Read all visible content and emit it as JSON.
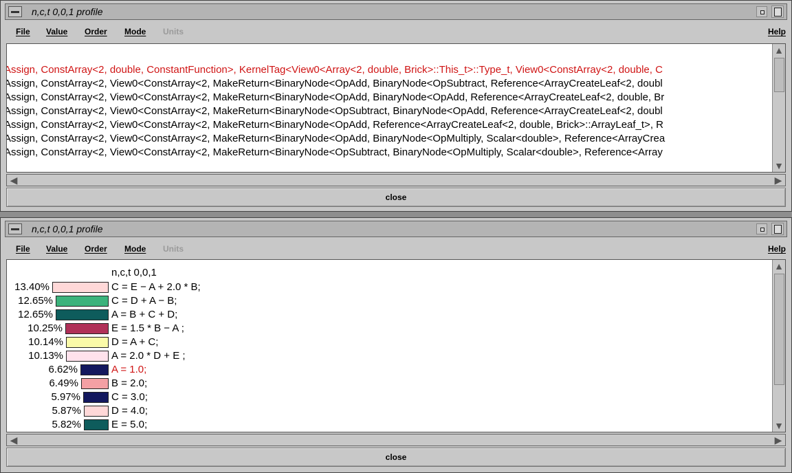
{
  "window_top": {
    "title": "n,c,t 0,0,1 profile",
    "menu": {
      "file": "File",
      "value": "Value",
      "order": "Order",
      "mode": "Mode",
      "units": "Units",
      "help": "Help"
    },
    "lines": [
      {
        "text": "Assign, ConstArray<2, double, ConstantFunction>, KernelTag<View0<Array<2, double, Brick>::This_t>::Type_t, View0<ConstArray<2, double, C",
        "highlight": true
      },
      {
        "text": "Assign, ConstArray<2, View0<ConstArray<2, MakeReturn<BinaryNode<OpAdd, BinaryNode<OpSubtract, Reference<ArrayCreateLeaf<2, doubl",
        "highlight": false
      },
      {
        "text": "Assign, ConstArray<2, View0<ConstArray<2, MakeReturn<BinaryNode<OpAdd, BinaryNode<OpAdd, Reference<ArrayCreateLeaf<2, double, Br",
        "highlight": false
      },
      {
        "text": "Assign, ConstArray<2, View0<ConstArray<2, MakeReturn<BinaryNode<OpSubtract, BinaryNode<OpAdd, Reference<ArrayCreateLeaf<2, doubl",
        "highlight": false
      },
      {
        "text": "Assign, ConstArray<2, View0<ConstArray<2, MakeReturn<BinaryNode<OpAdd, Reference<ArrayCreateLeaf<2, double, Brick>::ArrayLeaf_t>, R",
        "highlight": false
      },
      {
        "text": "Assign, ConstArray<2, View0<ConstArray<2, MakeReturn<BinaryNode<OpAdd, BinaryNode<OpMultiply, Scalar<double>, Reference<ArrayCrea",
        "highlight": false
      },
      {
        "text": "Assign, ConstArray<2, View0<ConstArray<2, MakeReturn<BinaryNode<OpSubtract, BinaryNode<OpMultiply, Scalar<double>, Reference<Array",
        "highlight": false
      }
    ],
    "close_label": "close"
  },
  "window_bottom": {
    "title": "n,c,t 0,0,1 profile",
    "menu": {
      "file": "File",
      "value": "Value",
      "order": "Order",
      "mode": "Mode",
      "units": "Units",
      "help": "Help"
    },
    "profile_title": "n,c,t 0,0,1",
    "rows": [
      {
        "pct": "13.40%",
        "value": 13.4,
        "color": "#ffd8d8",
        "stmt": "C = E − A + 2.0 * B;",
        "highlight": false
      },
      {
        "pct": "12.65%",
        "value": 12.65,
        "color": "#3cb37c",
        "stmt": "C = D + A − B;",
        "highlight": false
      },
      {
        "pct": "12.65%",
        "value": 12.65,
        "color": "#0e5c5c",
        "stmt": "A = B + C + D;",
        "highlight": false
      },
      {
        "pct": "10.25%",
        "value": 10.25,
        "color": "#b03058",
        "stmt": "E = 1.5 * B − A ;",
        "highlight": false
      },
      {
        "pct": "10.14%",
        "value": 10.14,
        "color": "#fafaa8",
        "stmt": "D = A + C;",
        "highlight": false
      },
      {
        "pct": "10.13%",
        "value": 10.13,
        "color": "#ffe2ec",
        "stmt": "A = 2.0 * D + E ;",
        "highlight": false
      },
      {
        "pct": "6.62%",
        "value": 6.62,
        "color": "#13185e",
        "stmt": "A = 1.0;",
        "highlight": true
      },
      {
        "pct": "6.49%",
        "value": 6.49,
        "color": "#f4a0a4",
        "stmt": "B = 2.0;",
        "highlight": false
      },
      {
        "pct": "5.97%",
        "value": 5.97,
        "color": "#13185e",
        "stmt": "C = 3.0;",
        "highlight": false
      },
      {
        "pct": "5.87%",
        "value": 5.87,
        "color": "#ffd8d8",
        "stmt": "D = 4.0;",
        "highlight": false
      },
      {
        "pct": "5.82%",
        "value": 5.82,
        "color": "#0e5c5c",
        "stmt": "E = 5.0;",
        "highlight": false
      }
    ],
    "close_label": "close"
  }
}
